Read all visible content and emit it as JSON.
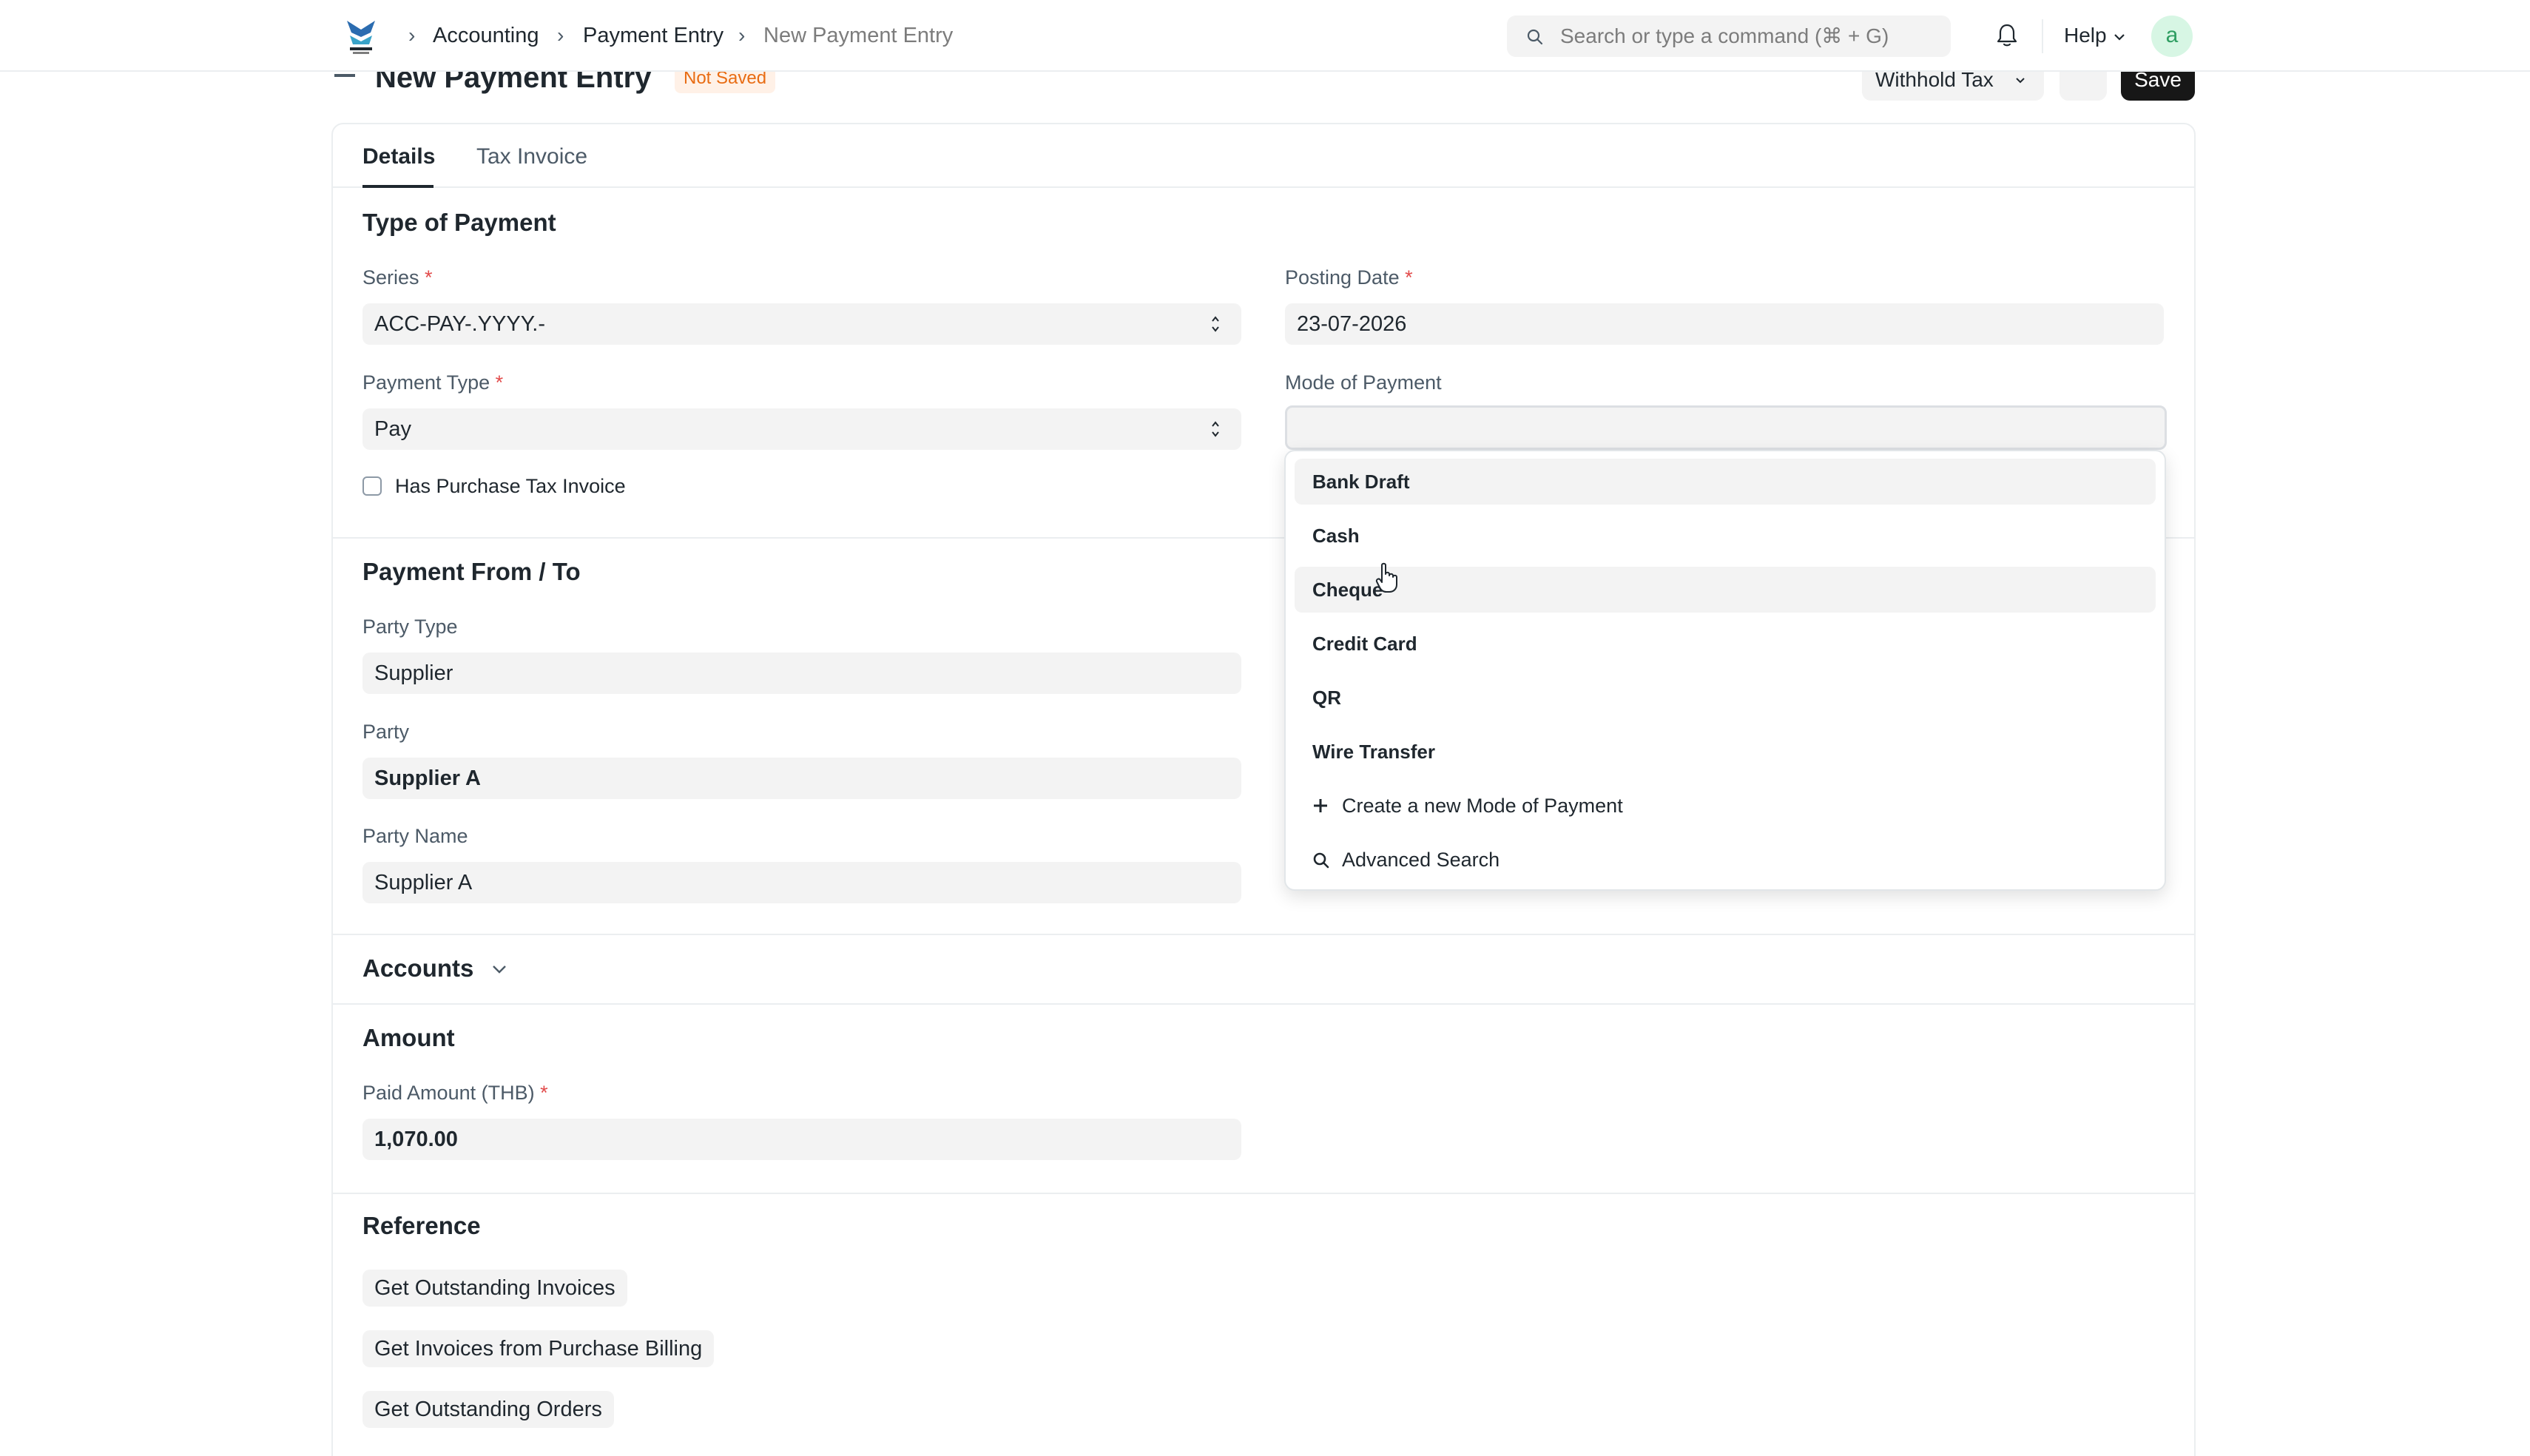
{
  "navbar": {
    "breadcrumbs": [
      "Accounting",
      "Payment Entry",
      "New Payment Entry"
    ],
    "search_placeholder": "Search or type a command (⌘ + G)",
    "help_label": "Help",
    "avatar_initial": "a"
  },
  "page": {
    "title": "New Payment Entry",
    "status_badge": "Not Saved",
    "withhold_tax_label": "Withhold Tax",
    "save_label": "Save"
  },
  "tabs": [
    "Details",
    "Tax Invoice"
  ],
  "type_of_payment": {
    "title": "Type of Payment",
    "series_label": "Series",
    "series_value": "ACC-PAY-.YYYY.-",
    "posting_date_label": "Posting Date",
    "posting_date_value": "23-07-2026",
    "payment_type_label": "Payment Type",
    "payment_type_value": "Pay",
    "mode_of_payment_label": "Mode of Payment",
    "mode_of_payment_value": "",
    "has_purchase_tax_invoice_label": "Has Purchase Tax Invoice",
    "has_purchase_tax_invoice_checked": false
  },
  "payment_from_to": {
    "title": "Payment From / To",
    "party_type_label": "Party Type",
    "party_type_value": "Supplier",
    "party_label": "Party",
    "party_value": "Supplier A",
    "party_name_label": "Party Name",
    "party_name_value": "Supplier A"
  },
  "accounts": {
    "title": "Accounts"
  },
  "amount": {
    "title": "Amount",
    "paid_amount_label": "Paid Amount (THB)",
    "paid_amount_value": "1,070.00"
  },
  "reference": {
    "title": "Reference",
    "buttons": [
      "Get Outstanding Invoices",
      "Get Invoices from Purchase Billing",
      "Get Outstanding Orders"
    ]
  },
  "mode_dropdown": {
    "options": [
      "Bank Draft",
      "Cash",
      "Cheque",
      "Credit Card",
      "QR",
      "Wire Transfer"
    ],
    "create_label": "Create a new Mode of Payment",
    "advanced_search_label": "Advanced Search"
  }
}
